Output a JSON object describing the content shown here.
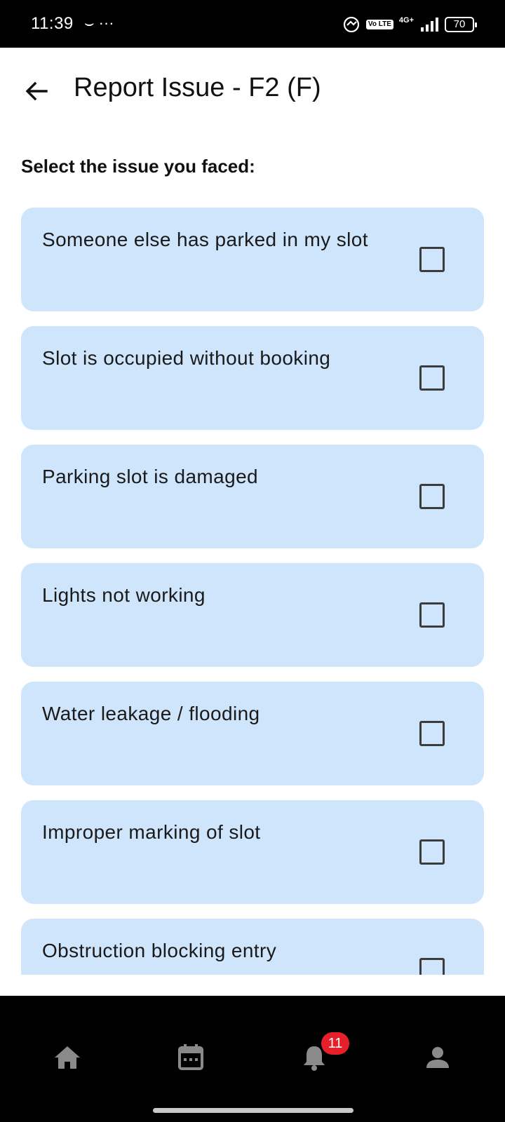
{
  "status_bar": {
    "time": "11:39",
    "left_icons": "⌣ ···",
    "volte": "Vo LTE",
    "network": "4G+",
    "battery": "70"
  },
  "header": {
    "title": "Report Issue - F2 (F)",
    "back_icon": "arrow-left-icon"
  },
  "prompt": "Select the issue you faced:",
  "issues": [
    {
      "label": "Someone else has parked in my slot",
      "checked": false
    },
    {
      "label": "Slot is occupied without booking",
      "checked": false
    },
    {
      "label": "Parking slot is damaged",
      "checked": false
    },
    {
      "label": "Lights not working",
      "checked": false
    },
    {
      "label": "Water leakage / flooding",
      "checked": false
    },
    {
      "label": "Improper marking of slot",
      "checked": false
    },
    {
      "label": "Obstruction blocking entry",
      "checked": false
    }
  ],
  "bottom_nav": {
    "items": [
      {
        "icon": "home-icon"
      },
      {
        "icon": "calendar-icon"
      },
      {
        "icon": "bell-icon"
      },
      {
        "icon": "person-icon"
      }
    ],
    "notification_count": "11"
  },
  "colors": {
    "card_background": "#cfe5fc",
    "badge": "#e5202a",
    "nav_icon": "#8a8a8a"
  }
}
